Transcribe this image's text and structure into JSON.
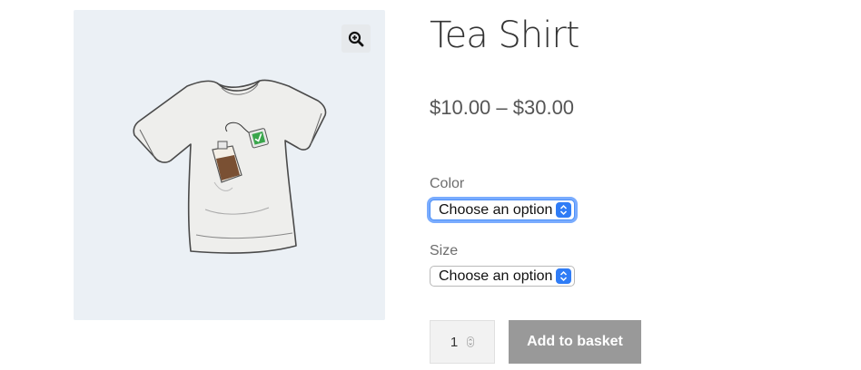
{
  "product": {
    "title": "Tea Shirt",
    "price_range": "$10.00 – $30.00",
    "image_icon": "tshirt-with-teabags"
  },
  "gallery": {
    "zoom_icon": "zoom-in-icon"
  },
  "variations": {
    "color": {
      "label": "Color",
      "selected": "Choose an option",
      "focused": true
    },
    "size": {
      "label": "Size",
      "selected": "Choose an option",
      "focused": false
    }
  },
  "cart": {
    "quantity": "1",
    "add_button_label": "Add to basket"
  },
  "colors": {
    "gallery_bg": "#ebf0f5",
    "focus_ring": "#7aacfe",
    "select_arrow": "#2f7cf6",
    "button_bg": "#999999"
  }
}
